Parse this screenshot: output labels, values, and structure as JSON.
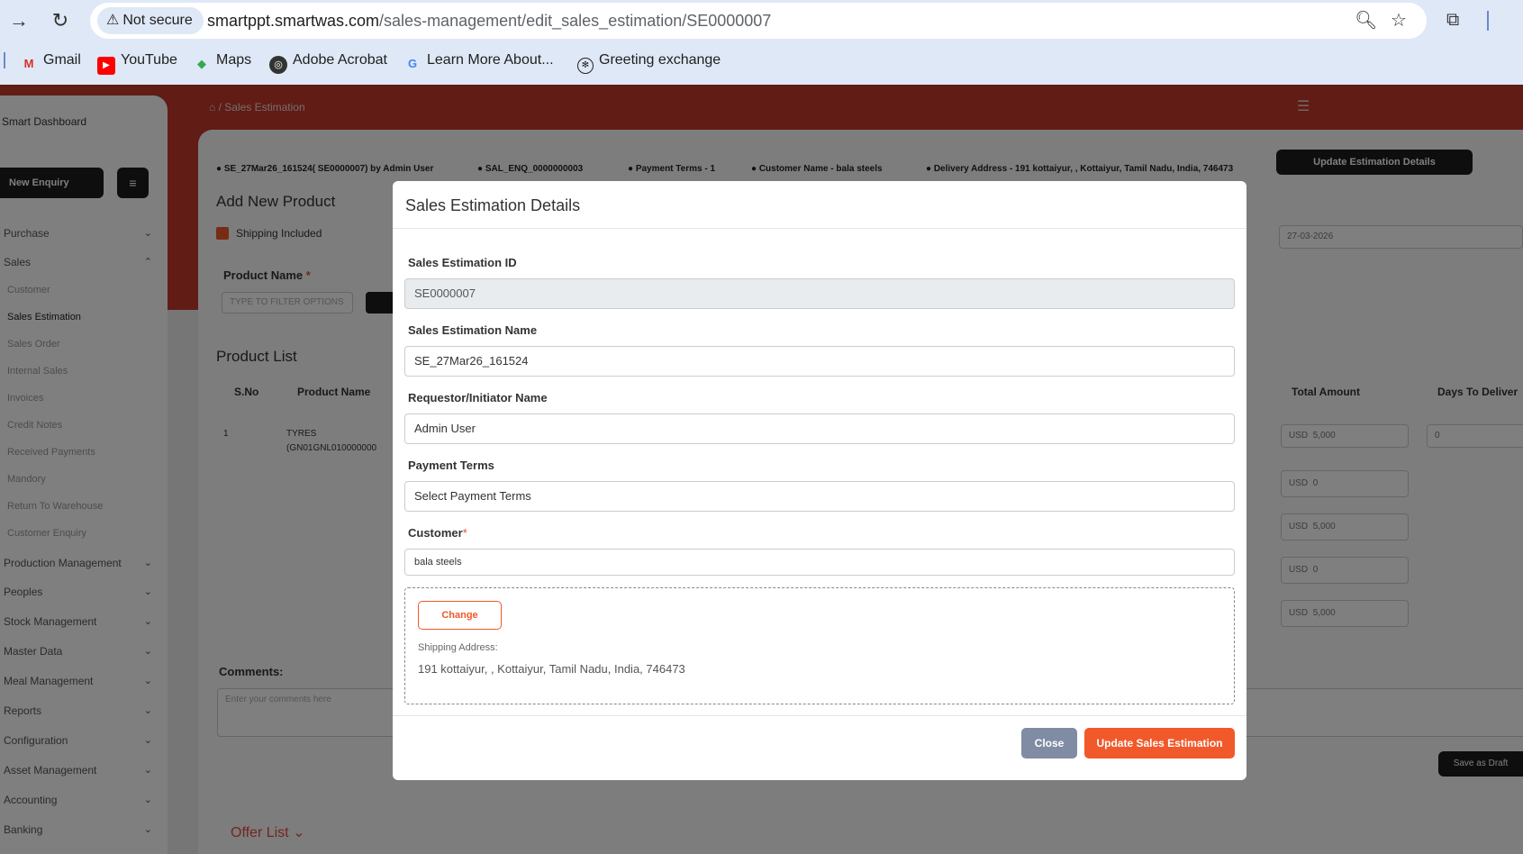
{
  "browser": {
    "security_label": "Not secure",
    "url_domain": "smartppt.smartwas.com",
    "url_path": "/sales-management/edit_sales_estimation/SE0000007",
    "bookmarks": [
      "Gmail",
      "YouTube",
      "Maps",
      "Adobe Acrobat",
      "Learn More About...",
      "Greeting exchange"
    ]
  },
  "background": {
    "dashboard_title": "Smart Dashboard",
    "new_enquiry": "New Enquiry",
    "breadcrumb": "/ Sales Estimation",
    "sidebar_items": [
      "Purchase",
      "Sales",
      "Production Management",
      "Peoples",
      "Stock Management",
      "Master Data",
      "Meal Management",
      "Reports",
      "Configuration",
      "Asset Management",
      "Accounting",
      "Banking"
    ],
    "sales_sub": [
      "Customer",
      "Sales Estimation",
      "Sales Order",
      "Internal Sales",
      "Invoices",
      "Credit Notes",
      "Received Payments",
      "Mandory",
      "Return To Warehouse",
      "Customer Enquiry"
    ],
    "info": {
      "est": "SE_27Mar26_161524( SE0000007) by Admin User",
      "enq": "SAL_ENQ_0000000003",
      "terms": "Payment Terms - 1",
      "customer": "Customer Name - bala steels",
      "address": "Delivery Address - 191 kottaiyur, , Kottaiyur, Tamil Nadu, India, 746473"
    },
    "update_details": "Update Estimation Details",
    "add_product": "Add New Product",
    "shipping_included": "Shipping Included",
    "product_name": "Product Name",
    "filter_placeholder": "TYPE TO FILTER OPTIONS",
    "date": "27-03-2026",
    "product_list": "Product List",
    "col_sno": "S.No",
    "col_product": "Product Name",
    "col_total": "Total Amount",
    "col_days": "Days To Deliver",
    "row_sno": "1",
    "row_product": "TYRES",
    "row_product_code": "(GN01GNL010000000",
    "currency": "USD",
    "amount_values": [
      "5,000",
      "0",
      "5,000",
      "0",
      "5,000"
    ],
    "days_value": "0",
    "comments_label": "Comments:",
    "comments_placeholder": "Enter your comments here",
    "save_draft": "Save as Draft",
    "offer_list": "Offer List"
  },
  "modal": {
    "title": "Sales Estimation Details",
    "fields": {
      "id_label": "Sales Estimation ID",
      "id_value": "SE0000007",
      "name_label": "Sales Estimation Name",
      "name_value": "SE_27Mar26_161524",
      "requestor_label": "Requestor/Initiator Name",
      "requestor_value": "Admin User",
      "terms_label": "Payment Terms",
      "terms_value": "Select Payment Terms",
      "customer_label": "Customer",
      "customer_required": "*",
      "customer_value": "bala steels"
    },
    "address": {
      "change_label": "Change",
      "shipping_label": "Shipping Address:",
      "shipping_value": "191 kottaiyur, , Kottaiyur, Tamil Nadu, India, 746473"
    },
    "close_label": "Close",
    "update_label": "Update Sales Estimation"
  }
}
